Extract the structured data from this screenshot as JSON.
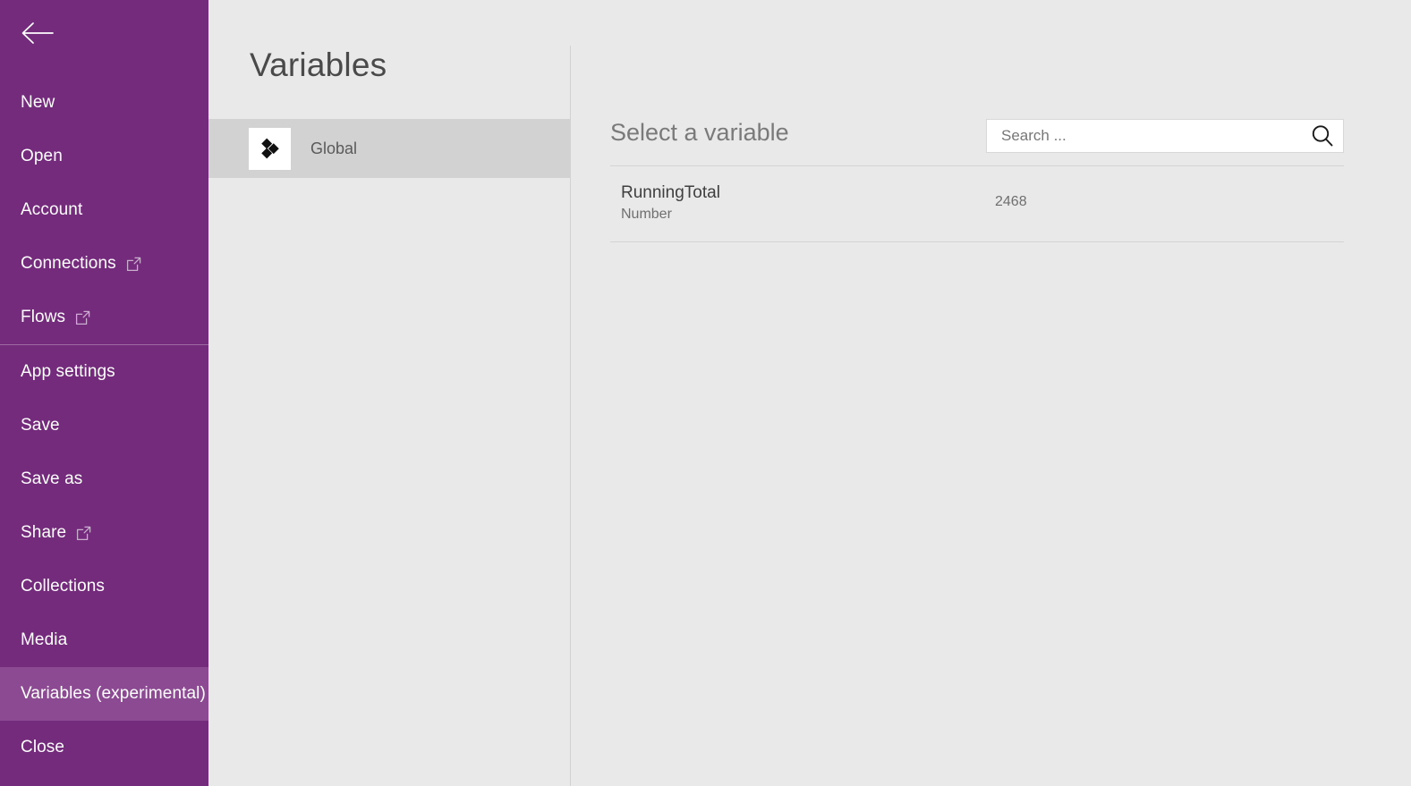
{
  "colors": {
    "sidebar_bg": "#742b7c",
    "sidebar_selected": "#8c4a93",
    "sidebar_divider": "#9d6aa3",
    "page_bg": "#e9e9e9",
    "scope_selected": "#d2d2d2",
    "rule": "#d4d4d4",
    "search_bg": "#ffffff"
  },
  "sidebar": {
    "back_icon": "arrow-left-icon",
    "items": [
      {
        "label": "New",
        "icon": null,
        "selected": false,
        "divider_after": false
      },
      {
        "label": "Open",
        "icon": null,
        "selected": false,
        "divider_after": false
      },
      {
        "label": "Account",
        "icon": null,
        "selected": false,
        "divider_after": false
      },
      {
        "label": "Connections",
        "icon": "external-link-icon",
        "selected": false,
        "divider_after": false
      },
      {
        "label": "Flows",
        "icon": "external-link-icon",
        "selected": false,
        "divider_after": true
      },
      {
        "label": "App settings",
        "icon": null,
        "selected": false,
        "divider_after": false
      },
      {
        "label": "Save",
        "icon": null,
        "selected": false,
        "divider_after": false
      },
      {
        "label": "Save as",
        "icon": null,
        "selected": false,
        "divider_after": false
      },
      {
        "label": "Share",
        "icon": "external-link-icon",
        "selected": false,
        "divider_after": false
      },
      {
        "label": "Collections",
        "icon": null,
        "selected": false,
        "divider_after": false
      },
      {
        "label": "Media",
        "icon": null,
        "selected": false,
        "divider_after": false
      },
      {
        "label": "Variables (experimental)",
        "icon": null,
        "selected": true,
        "divider_after": false
      },
      {
        "label": "Close",
        "icon": null,
        "selected": false,
        "divider_after": false
      }
    ]
  },
  "panel": {
    "title": "Variables",
    "scopes": [
      {
        "label": "Global",
        "icon": "global-diamonds-icon",
        "selected": true
      }
    ]
  },
  "main": {
    "title": "Select a variable",
    "search": {
      "placeholder": "Search ...",
      "value": "",
      "icon": "search-icon"
    },
    "variables": [
      {
        "name": "RunningTotal",
        "type": "Number",
        "value": "2468"
      }
    ]
  }
}
